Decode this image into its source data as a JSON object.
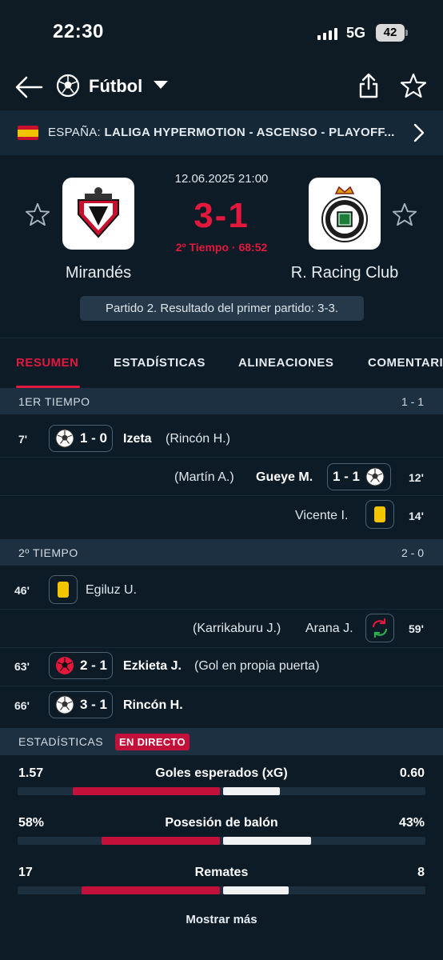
{
  "status_bar": {
    "time": "22:30",
    "network": "5G",
    "battery": "42"
  },
  "nav": {
    "sport": "Fútbol"
  },
  "league": {
    "country": "ESPAÑA:",
    "competition": "LALIGA HYPERMOTION - ASCENSO - PLAYOFF..."
  },
  "match": {
    "datetime": "12.06.2025 21:00",
    "score": "3-1",
    "phase": "2º Tiempo · 68:52",
    "home": {
      "name": "Mirandés"
    },
    "away": {
      "name": "R. Racing Club"
    },
    "note": "Partido 2. Resultado del primer partido: 3-3."
  },
  "tabs": [
    "RESUMEN",
    "ESTADÍSTICAS",
    "ALINEACIONES",
    "COMENTARI"
  ],
  "first_half": {
    "label": "1ER TIEMPO",
    "score": "1 - 1",
    "events": [
      {
        "minute": "7'",
        "score": "1 - 0",
        "player": "Izeta",
        "detail": "(Rincón H.)"
      },
      {
        "minute": "12'",
        "score": "1 - 1",
        "player": "Gueye M.",
        "detail": "(Martín A.)"
      },
      {
        "minute": "14'",
        "player": "Vicente I."
      }
    ]
  },
  "second_half": {
    "label": "2º TIEMPO",
    "score": "2 - 0",
    "events": [
      {
        "minute": "46'",
        "player": "Egiluz U."
      },
      {
        "minute": "59'",
        "player": "Arana J.",
        "detail": "(Karrikaburu J.)"
      },
      {
        "minute": "63'",
        "score": "2 - 1",
        "player": "Ezkieta J.",
        "detail": "(Gol en propia puerta)"
      },
      {
        "minute": "66'",
        "score": "3 - 1",
        "player": "Rincón H."
      }
    ]
  },
  "stats": {
    "title": "ESTADÍSTICAS",
    "live": "EN DIRECTO",
    "rows": [
      {
        "name": "Goles esperados (xG)",
        "home": "1.57",
        "away": "0.60",
        "home_share": 0.72,
        "away_share": 0.28
      },
      {
        "name": "Posesión de balón",
        "home": "58%",
        "away": "43%",
        "home_share": 0.58,
        "away_share": 0.43
      },
      {
        "name": "Remates",
        "home": "17",
        "away": "8",
        "home_share": 0.68,
        "away_share": 0.32
      }
    ],
    "more": "Mostrar más"
  },
  "colors": {
    "accent": "#e4183d",
    "bar_home": "#c2103a",
    "bar_away": "#f0f2f4",
    "yellow_card": "#f3c500"
  }
}
